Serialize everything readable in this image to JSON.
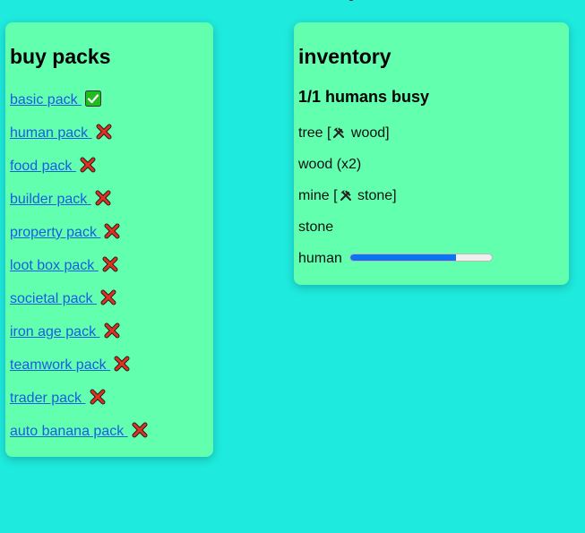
{
  "packs_panel": {
    "title": "buy packs",
    "items": [
      {
        "label": "basic pack",
        "status": "check",
        "available": true
      },
      {
        "label": "human pack",
        "status": "cross",
        "available": false
      },
      {
        "label": "food pack",
        "status": "cross",
        "available": false
      },
      {
        "label": "builder pack",
        "status": "cross",
        "available": false
      },
      {
        "label": "property pack",
        "status": "cross",
        "available": false
      },
      {
        "label": "loot box pack",
        "status": "cross",
        "available": false
      },
      {
        "label": "societal pack",
        "status": "cross",
        "available": false
      },
      {
        "label": "iron age pack",
        "status": "cross",
        "available": false
      },
      {
        "label": "teamwork pack",
        "status": "cross",
        "available": false
      },
      {
        "label": "trader pack",
        "status": "cross",
        "available": false
      },
      {
        "label": "auto banana pack",
        "status": "cross",
        "available": false
      }
    ]
  },
  "inventory_panel": {
    "title": "inventory",
    "busy": "1/1 humans busy",
    "rows": {
      "tree": {
        "pre": "tree [",
        "icon": "hammer-pick-icon",
        "post": " wood]"
      },
      "wood": {
        "text": "wood (x2)"
      },
      "mine": {
        "pre": "mine [",
        "icon": "hammer-pick-icon",
        "post": " stone]"
      },
      "stone": {
        "text": "stone"
      },
      "human": {
        "text": "human",
        "progress": 0.75
      }
    }
  },
  "colors": {
    "background": "#1eeadd",
    "panel": "#62ffae",
    "link": "#1a5de0",
    "progress_fill": "#0f72f0",
    "check_green": "#22bb22",
    "cross_red": "#e03020"
  }
}
